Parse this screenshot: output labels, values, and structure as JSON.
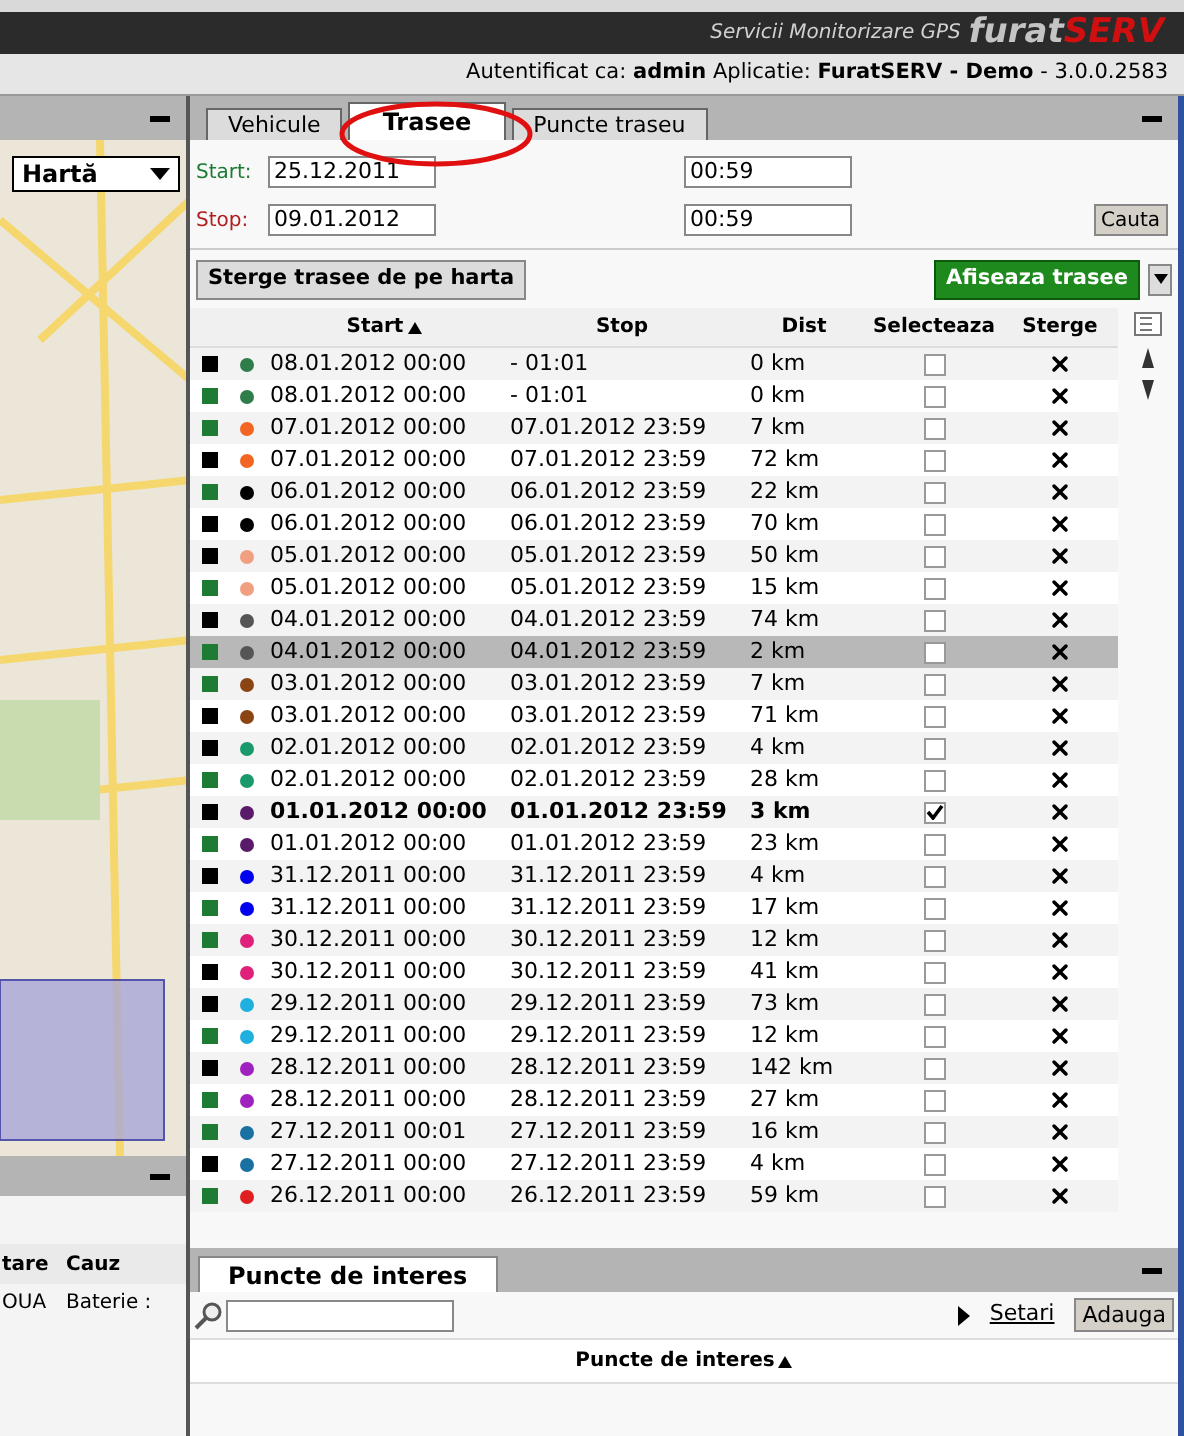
{
  "header": {
    "tagline": "Servicii Monitorizare GPS",
    "logo_part1": "furat",
    "logo_part2": "SERV"
  },
  "auth_bar": {
    "label": "Autentificat ca:",
    "user": "admin",
    "app_label": "Aplicatie:",
    "app": "FuratSERV - Demo",
    "version": "- 3.0.0.2583"
  },
  "map_panel": {
    "map_type": "Hartă"
  },
  "alerts_panel": {
    "columns": [
      "tare",
      "Cauz"
    ],
    "rows": [
      [
        "OUA",
        "Baterie :"
      ]
    ]
  },
  "tabs": [
    {
      "label": "Vehicule",
      "selected": false
    },
    {
      "label": "Trasee",
      "selected": true
    },
    {
      "label": "Puncte traseu",
      "selected": false
    }
  ],
  "form": {
    "start_label": "Start:",
    "start_date": "25.12.2011",
    "start_time": "00:59",
    "stop_label": "Stop:",
    "stop_date": "09.01.2012",
    "stop_time": "00:59",
    "search_button": "Cauta"
  },
  "actions": {
    "clear_button": "Sterge trasee de pe harta",
    "show_button": "Afiseaza trasee"
  },
  "table": {
    "columns": [
      "Start",
      "Stop",
      "Dist",
      "Selecteaza",
      "Sterge"
    ],
    "rows": [
      {
        "green_marker": false,
        "color": "#2e7d4a",
        "start": "08.01.2012 00:00",
        "stop": "- 01:01",
        "dist": "0 km",
        "checked": false,
        "selected": false
      },
      {
        "green_marker": true,
        "color": "#2e7d4a",
        "start": "08.01.2012 00:00",
        "stop": "- 01:01",
        "dist": "0 km",
        "checked": false,
        "selected": false
      },
      {
        "green_marker": true,
        "color": "#f26522",
        "start": "07.01.2012 00:00",
        "stop": "07.01.2012 23:59",
        "dist": "7 km",
        "checked": false,
        "selected": false
      },
      {
        "green_marker": false,
        "color": "#f26522",
        "start": "07.01.2012 00:00",
        "stop": "07.01.2012 23:59",
        "dist": "72 km",
        "checked": false,
        "selected": false
      },
      {
        "green_marker": true,
        "color": "#000000",
        "start": "06.01.2012 00:00",
        "stop": "06.01.2012 23:59",
        "dist": "22 km",
        "checked": false,
        "selected": false
      },
      {
        "green_marker": false,
        "color": "#000000",
        "start": "06.01.2012 00:00",
        "stop": "06.01.2012 23:59",
        "dist": "70 km",
        "checked": false,
        "selected": false
      },
      {
        "green_marker": false,
        "color": "#f0a080",
        "start": "05.01.2012 00:00",
        "stop": "05.01.2012 23:59",
        "dist": "50 km",
        "checked": false,
        "selected": false
      },
      {
        "green_marker": true,
        "color": "#f0a080",
        "start": "05.01.2012 00:00",
        "stop": "05.01.2012 23:59",
        "dist": "15 km",
        "checked": false,
        "selected": false
      },
      {
        "green_marker": false,
        "color": "#555555",
        "start": "04.01.2012 00:00",
        "stop": "04.01.2012 23:59",
        "dist": "74 km",
        "checked": false,
        "selected": false
      },
      {
        "green_marker": true,
        "color": "#555555",
        "start": "04.01.2012 00:00",
        "stop": "04.01.2012 23:59",
        "dist": "2 km",
        "checked": false,
        "selected": true
      },
      {
        "green_marker": true,
        "color": "#8b4513",
        "start": "03.01.2012 00:00",
        "stop": "03.01.2012 23:59",
        "dist": "7 km",
        "checked": false,
        "selected": false
      },
      {
        "green_marker": false,
        "color": "#8b4513",
        "start": "03.01.2012 00:00",
        "stop": "03.01.2012 23:59",
        "dist": "71 km",
        "checked": false,
        "selected": false
      },
      {
        "green_marker": false,
        "color": "#1a9a6a",
        "start": "02.01.2012 00:00",
        "stop": "02.01.2012 23:59",
        "dist": "4 km",
        "checked": false,
        "selected": false
      },
      {
        "green_marker": true,
        "color": "#1a9a6a",
        "start": "02.01.2012 00:00",
        "stop": "02.01.2012 23:59",
        "dist": "28 km",
        "checked": false,
        "selected": false
      },
      {
        "green_marker": false,
        "color": "#5a1a6a",
        "start": "01.01.2012 00:00",
        "stop": "01.01.2012 23:59",
        "dist": "3 km",
        "checked": true,
        "selected": false
      },
      {
        "green_marker": true,
        "color": "#5a1a6a",
        "start": "01.01.2012 00:00",
        "stop": "01.01.2012 23:59",
        "dist": "23 km",
        "checked": false,
        "selected": false
      },
      {
        "green_marker": false,
        "color": "#0000ee",
        "start": "31.12.2011 00:00",
        "stop": "31.12.2011 23:59",
        "dist": "4 km",
        "checked": false,
        "selected": false
      },
      {
        "green_marker": true,
        "color": "#0000ee",
        "start": "31.12.2011 00:00",
        "stop": "31.12.2011 23:59",
        "dist": "17 km",
        "checked": false,
        "selected": false
      },
      {
        "green_marker": true,
        "color": "#e0207a",
        "start": "30.12.2011 00:00",
        "stop": "30.12.2011 23:59",
        "dist": "12 km",
        "checked": false,
        "selected": false
      },
      {
        "green_marker": false,
        "color": "#e0207a",
        "start": "30.12.2011 00:00",
        "stop": "30.12.2011 23:59",
        "dist": "41 km",
        "checked": false,
        "selected": false
      },
      {
        "green_marker": false,
        "color": "#20b0e0",
        "start": "29.12.2011 00:00",
        "stop": "29.12.2011 23:59",
        "dist": "73 km",
        "checked": false,
        "selected": false
      },
      {
        "green_marker": true,
        "color": "#20b0e0",
        "start": "29.12.2011 00:00",
        "stop": "29.12.2011 23:59",
        "dist": "12 km",
        "checked": false,
        "selected": false
      },
      {
        "green_marker": false,
        "color": "#a020c0",
        "start": "28.12.2011 00:00",
        "stop": "28.12.2011 23:59",
        "dist": "142 km",
        "checked": false,
        "selected": false
      },
      {
        "green_marker": true,
        "color": "#a020c0",
        "start": "28.12.2011 00:00",
        "stop": "28.12.2011 23:59",
        "dist": "27 km",
        "checked": false,
        "selected": false
      },
      {
        "green_marker": true,
        "color": "#1a70a0",
        "start": "27.12.2011 00:01",
        "stop": "27.12.2011 23:59",
        "dist": "16 km",
        "checked": false,
        "selected": false
      },
      {
        "green_marker": false,
        "color": "#1a70a0",
        "start": "27.12.2011 00:00",
        "stop": "27.12.2011 23:59",
        "dist": "4 km",
        "checked": false,
        "selected": false
      },
      {
        "green_marker": true,
        "color": "#e02020",
        "start": "26.12.2011 00:00",
        "stop": "26.12.2011 23:59",
        "dist": "59 km",
        "checked": false,
        "selected": false
      }
    ]
  },
  "poi": {
    "tab": "Puncte de interes",
    "settings_link": "Setari",
    "add_button": "Adauga",
    "column": "Puncte de interes"
  }
}
